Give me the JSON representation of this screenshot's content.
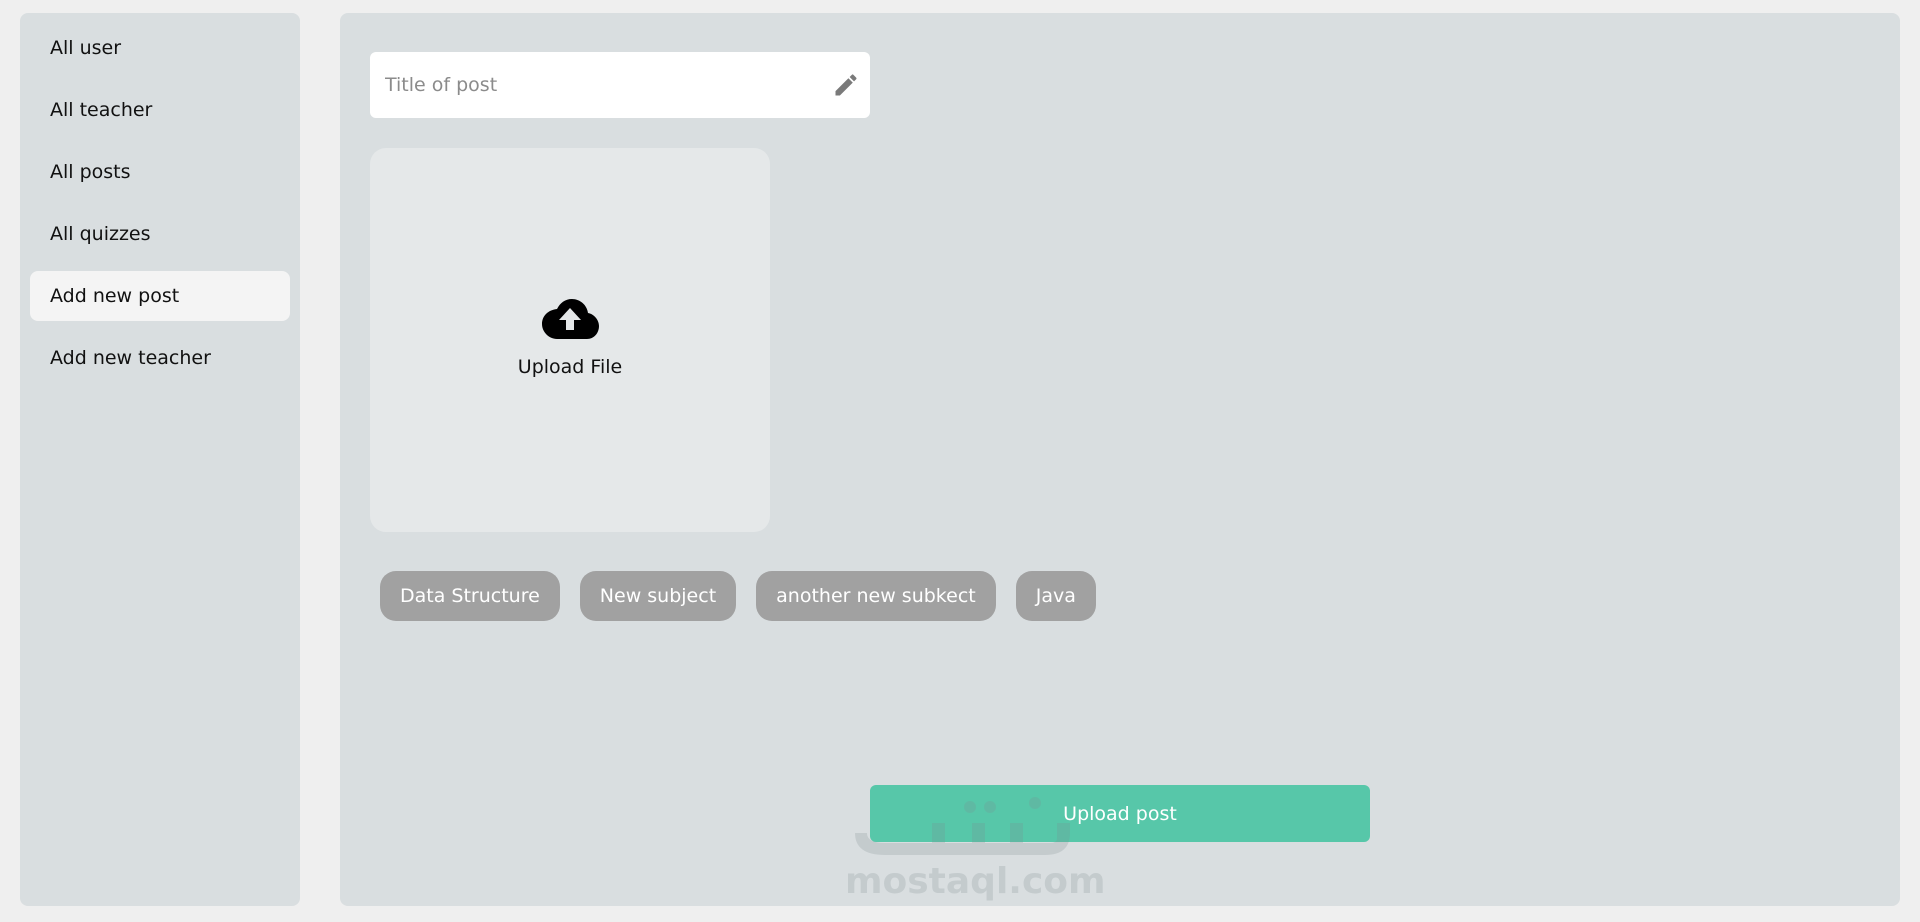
{
  "sidebar": {
    "items": [
      {
        "label": "All user"
      },
      {
        "label": "All teacher"
      },
      {
        "label": "All posts"
      },
      {
        "label": "All quizzes"
      },
      {
        "label": "Add new post",
        "active": true
      },
      {
        "label": "Add new teacher"
      }
    ]
  },
  "form": {
    "title_placeholder": "Title of post",
    "title_value": "",
    "title_icon": "pencil-icon",
    "upload_icon": "cloud-upload-icon",
    "upload_label": "Upload File",
    "tags": [
      "Data Structure",
      "New subject",
      "another new subkect",
      "Java"
    ],
    "submit_label": "Upload post"
  },
  "watermark": {
    "text": "mostaql.com"
  },
  "colors": {
    "page_bg": "#efefef",
    "panel_bg": "#d9dee0",
    "active_item_bg": "#f4f4f4",
    "upload_box_bg": "#e5e8e9",
    "tag_bg": "#a1a1a1",
    "submit_bg": "#57c7a9"
  }
}
